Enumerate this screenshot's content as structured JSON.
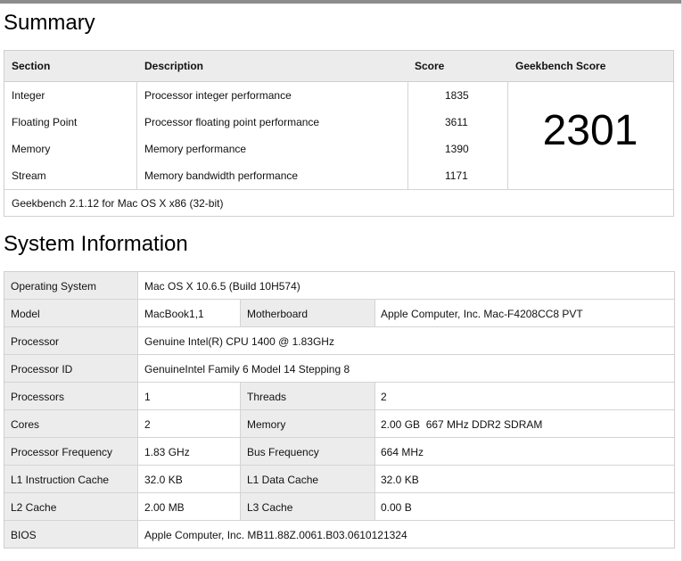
{
  "summary": {
    "title": "Summary",
    "headers": {
      "section": "Section",
      "description": "Description",
      "score": "Score",
      "geekbench_score": "Geekbench Score"
    },
    "rows": [
      {
        "section": "Integer",
        "description": "Processor integer performance",
        "score": "1835"
      },
      {
        "section": "Floating Point",
        "description": "Processor floating point performance",
        "score": "3611"
      },
      {
        "section": "Memory",
        "description": "Memory performance",
        "score": "1390"
      },
      {
        "section": "Stream",
        "description": "Memory bandwidth performance",
        "score": "1171"
      }
    ],
    "overall_score": "2301",
    "footer": "Geekbench 2.1.12 for Mac OS X x86 (32-bit)"
  },
  "system_info": {
    "title": "System Information",
    "rows": [
      {
        "label": "Operating System",
        "value": "Mac OS X 10.6.5 (Build 10H574)"
      },
      {
        "label": "Model",
        "value": "MacBook1,1",
        "label2": "Motherboard",
        "value2": "Apple Computer, Inc. Mac-F4208CC8 PVT"
      },
      {
        "label": "Processor",
        "value": "Genuine Intel(R) CPU 1400 @ 1.83GHz"
      },
      {
        "label": "Processor ID",
        "value": "GenuineIntel Family 6 Model 14 Stepping 8"
      },
      {
        "label": "Processors",
        "value": "1",
        "label2": "Threads",
        "value2": "2"
      },
      {
        "label": "Cores",
        "value": "2",
        "label2": "Memory",
        "value2": "2.00 GB  667 MHz DDR2 SDRAM"
      },
      {
        "label": "Processor Frequency",
        "value": "1.83 GHz",
        "label2": "Bus Frequency",
        "value2": "664 MHz"
      },
      {
        "label": "L1 Instruction Cache",
        "value": "32.0 KB",
        "label2": "L1 Data Cache",
        "value2": "32.0 KB"
      },
      {
        "label": "L2 Cache",
        "value": "2.00 MB",
        "label2": "L3 Cache",
        "value2": "0.00 B"
      },
      {
        "label": "BIOS",
        "value": "Apple Computer, Inc. MB11.88Z.0061.B03.0610121324"
      }
    ]
  }
}
